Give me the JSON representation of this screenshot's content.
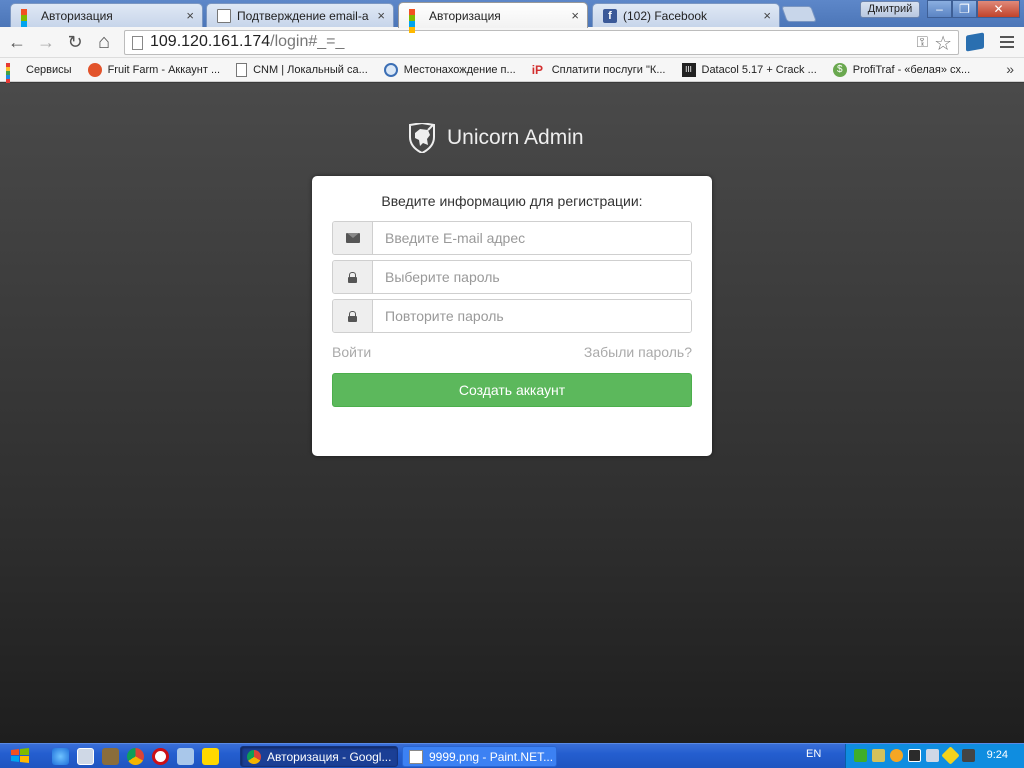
{
  "browser": {
    "tabs": [
      {
        "title": "Авторизация",
        "icon": "ms-logo-icon",
        "close": "×"
      },
      {
        "title": "Подтверждение email-а - В",
        "icon": "page-icon",
        "close": "×"
      },
      {
        "title": "Авторизация",
        "icon": "ms-logo-icon",
        "close": "×",
        "active": true
      },
      {
        "title": "(102) Facebook",
        "icon": "facebook-icon",
        "close": "×"
      }
    ],
    "user": "Дмитрий",
    "window_controls": {
      "minimize": "‒",
      "restore": "❐",
      "close": "✕"
    },
    "nav": {
      "back": "←",
      "forward": "→",
      "reload": "↻",
      "home": "⌂"
    },
    "address": {
      "host": "109.120.161.174",
      "path": "/login#_=_"
    },
    "bookmarks": [
      {
        "label": "Сервисы",
        "icon": "apps-icon"
      },
      {
        "label": "Fruit Farm - Аккаунт ...",
        "icon": "fruit-icon"
      },
      {
        "label": "CNM | Локальный са...",
        "icon": "page-icon"
      },
      {
        "label": "Местонахождение п...",
        "icon": "globe-icon"
      },
      {
        "label": "Сплатити послуги \"К...",
        "icon": "ip-icon"
      },
      {
        "label": "Datacol 5.17 + Crack ...",
        "icon": "datacol-icon"
      },
      {
        "label": "ProfiTraf - «белая» сх...",
        "icon": "coin-icon"
      }
    ],
    "bookmarks_more": "»"
  },
  "page": {
    "brand": "Unicorn Admin",
    "form": {
      "heading": "Введите информацию для регистрации:",
      "email_placeholder": "Введите E-mail адрес",
      "password_placeholder": "Выберите пароль",
      "confirm_placeholder": "Повторите пароль",
      "login_link": "Войти",
      "forgot_link": "Забыли пароль?",
      "submit": "Создать аккаунт"
    },
    "colors": {
      "submit": "#5cb85c",
      "background_top": "#4a4a4a",
      "background_bottom": "#1e1e1e"
    }
  },
  "taskbar": {
    "tasks": [
      {
        "label": "Авторизация - Googl...",
        "icon": "chrome-icon",
        "active": true
      },
      {
        "label": "9999.png - Paint.NET...",
        "icon": "paintnet-icon",
        "active": false
      }
    ],
    "language": "EN",
    "clock": "9:24"
  }
}
